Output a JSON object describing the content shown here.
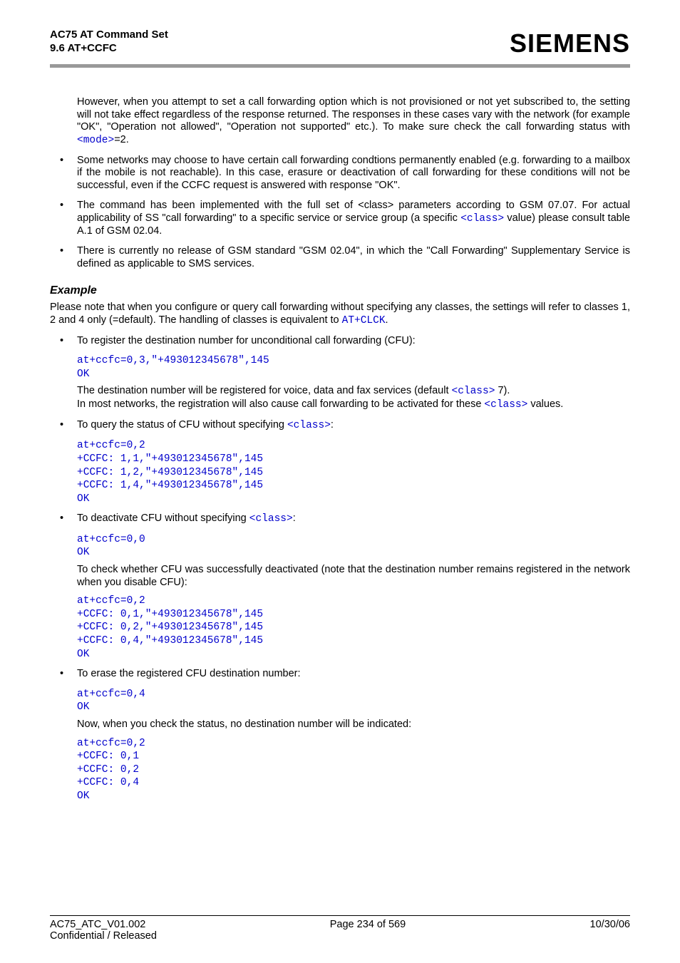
{
  "header": {
    "title": "AC75 AT Command Set",
    "section": "9.6 AT+CCFC",
    "brand": "SIEMENS"
  },
  "intro": {
    "para": "However, when you attempt to set a call forwarding option which is not provisioned or not yet subscribed to, the setting will not take effect regardless of the response returned. The responses in these cases vary with the network (for example \"OK\", \"Operation not allowed\", \"Operation not supported\" etc.). To make sure check the call forwarding status with ",
    "mode_link": "<mode>",
    "para_tail": "=2."
  },
  "bullets_top": [
    "Some networks may choose to have certain call forwarding condtions permanently enabled (e.g. forwarding to a mailbox if the mobile is not reachable). In this case, erasure or deactivation of call forwarding for these conditions will not be successful, even if the CCFC request is answered with response \"OK\".",
    {
      "pre": "The command has been implemented with the full set of <class> parameters according to GSM 07.07. For actual applicability of SS \"call forwarding\" to a specific service or service group (a specific ",
      "link": "<class>",
      "post": " value) please consult table A.1 of GSM 02.04."
    },
    "There is currently no release of GSM standard \"GSM 02.04\", in which the \"Call Forwarding\" Supplementary Service is defined as applicable to SMS services."
  ],
  "example": {
    "heading": "Example",
    "intro_pre": "Please note that when you configure or query call forwarding without specifying any classes, the settings will refer to classes 1, 2 and 4 only (=default). The handling of classes is equivalent to ",
    "intro_link": "AT+CLCK",
    "intro_post": ".",
    "b1": {
      "text": "To register the destination number for unconditional call forwarding (CFU):",
      "code": "at+ccfc=0,3,\"+493012345678\",145\nOK",
      "after_pre": "The destination number will be registered for voice, data and fax services (default ",
      "after_link1": "<class>",
      "after_mid": " 7).\nIn most networks, the registration will also cause call forwarding to be activated for these ",
      "after_link2": "<class>",
      "after_post": " values."
    },
    "b2": {
      "pre": "To query the status of CFU without specifying ",
      "link": "<class>",
      "post": ":",
      "code": "at+ccfc=0,2\n+CCFC: 1,1,\"+493012345678\",145\n+CCFC: 1,2,\"+493012345678\",145\n+CCFC: 1,4,\"+493012345678\",145\nOK"
    },
    "b3": {
      "pre": "To deactivate CFU without specifying ",
      "link": "<class>",
      "post": ":",
      "code1": "at+ccfc=0,0\nOK",
      "mid": "To check whether CFU was successfully deactivated (note that the destination number remains registered in the network when you disable CFU):",
      "code2": "at+ccfc=0,2\n+CCFC: 0,1,\"+493012345678\",145\n+CCFC: 0,2,\"+493012345678\",145\n+CCFC: 0,4,\"+493012345678\",145\nOK"
    },
    "b4": {
      "text": "To erase the registered CFU destination number:",
      "code1": "at+ccfc=0,4\nOK",
      "mid": "Now, when you check the status, no destination number will be indicated:",
      "code2": "at+ccfc=0,2\n+CCFC: 0,1\n+CCFC: 0,2\n+CCFC: 0,4\nOK"
    }
  },
  "footer": {
    "left1": "AC75_ATC_V01.002",
    "center": "Page 234 of 569",
    "right": "10/30/06",
    "left2": "Confidential / Released"
  }
}
